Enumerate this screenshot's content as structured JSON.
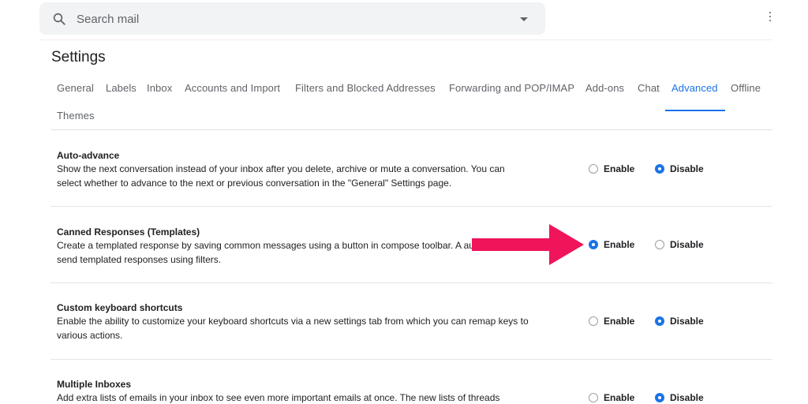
{
  "search": {
    "placeholder": "Search mail"
  },
  "page": {
    "title": "Settings"
  },
  "tabs": [
    {
      "label": "General"
    },
    {
      "label": "Labels"
    },
    {
      "label": "Inbox"
    },
    {
      "label": "Accounts and Import"
    },
    {
      "label": "Filters and Blocked Addresses"
    },
    {
      "label": "Forwarding and POP/IMAP"
    },
    {
      "label": "Add-ons"
    },
    {
      "label": "Chat"
    },
    {
      "label": "Advanced",
      "active": true
    },
    {
      "label": "Offline"
    },
    {
      "label": "Themes"
    }
  ],
  "options": {
    "enable": "Enable",
    "disable": "Disable"
  },
  "settings": [
    {
      "title": "Auto-advance",
      "desc": "Show the next conversation instead of your inbox after you delete, archive or mute a conversation. You can select whether to advance to the next or previous conversation in the \"General\" Settings page.",
      "selected": "disable"
    },
    {
      "title": "Canned Responses (Templates)",
      "desc": "Create a templated response by saving common messages using a button in compose toolbar. A automatically send templated responses using filters.",
      "selected": "enable"
    },
    {
      "title": "Custom keyboard shortcuts",
      "desc": "Enable the ability to customize your keyboard shortcuts via a new settings tab from which you can remap keys to various actions.",
      "selected": "disable"
    },
    {
      "title": "Multiple Inboxes",
      "desc": "Add extra lists of emails in your inbox to see even more important emails at once. The new lists of threads",
      "selected": "disable"
    }
  ],
  "colors": {
    "accent": "#1a73e8",
    "annotation_arrow": "#f0145a"
  }
}
